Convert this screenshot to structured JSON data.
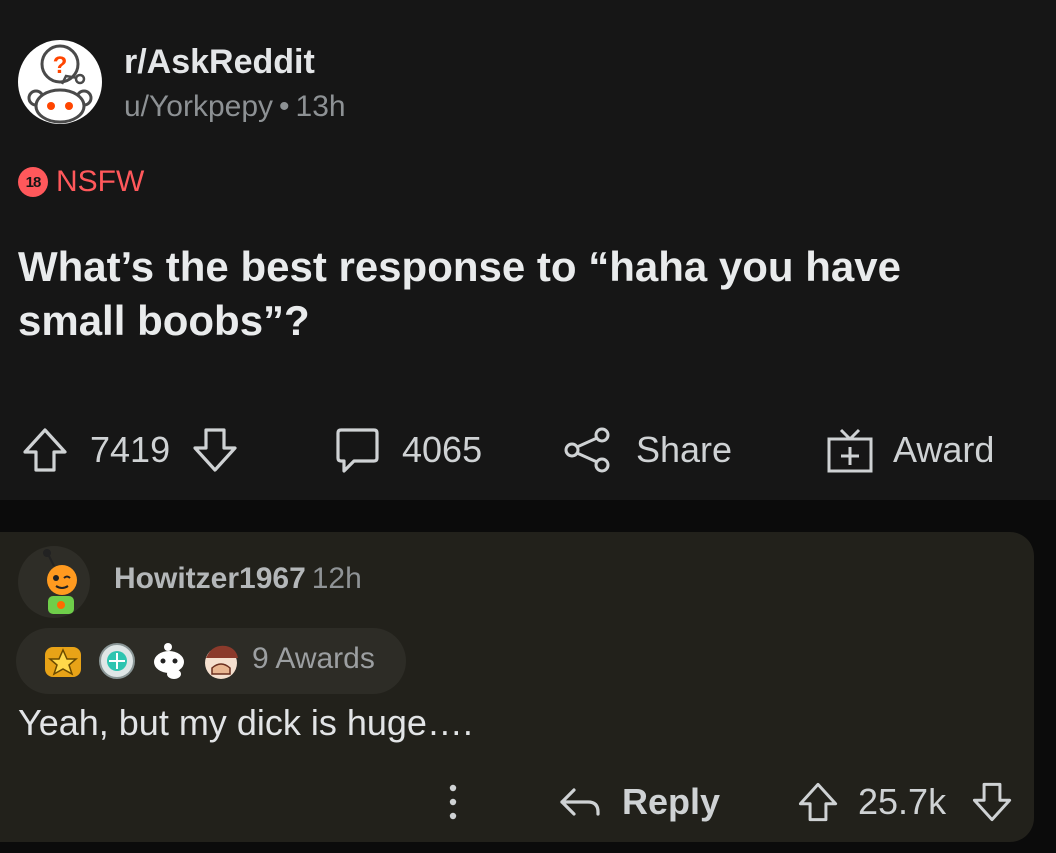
{
  "post": {
    "subreddit": "r/AskReddit",
    "author": "u/Yorkpepy",
    "age": "13h",
    "nsfw_badge": "18",
    "nsfw_label": "NSFW",
    "title": "What’s the best response to “haha you have small boobs”?",
    "votes": "7419",
    "comments": "4065",
    "share_label": "Share",
    "award_label": "Award"
  },
  "comment": {
    "author": "Howitzer1967",
    "age": "12h",
    "awards_label": "9 Awards",
    "body": "Yeah, but my dick is huge….",
    "reply_label": "Reply",
    "votes": "25.7k"
  },
  "icons": {
    "subreddit_avatar": "askreddit-snoo-icon",
    "upvote": "arrow-up-outline-icon",
    "downvote": "arrow-down-outline-icon",
    "comment": "speech-bubble-icon",
    "share": "share-nodes-icon",
    "award": "gift-box-icon",
    "more": "vertical-dots-icon",
    "reply": "reply-arrow-icon"
  },
  "colors": {
    "post_bg": "#161616",
    "comment_bg": "#22211b",
    "nsfw": "#ff585b",
    "text_primary": "#e9ebec",
    "text_muted": "#8d9194"
  }
}
